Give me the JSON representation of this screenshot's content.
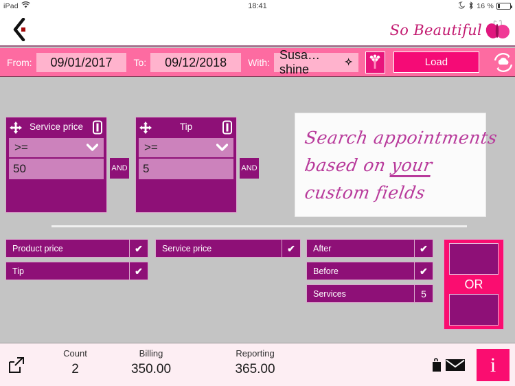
{
  "status_bar": {
    "device": "iPad",
    "wifi_icon": "wifi-icon",
    "time": "18:41",
    "moon_icon": "do-not-disturb-icon",
    "bluetooth_icon": "bluetooth-icon",
    "battery_percent": "16 %"
  },
  "header": {
    "back_icon": "back-chevron-icon",
    "logo_text": "So Beautiful",
    "butterfly_icon": "butterfly-icon"
  },
  "toolbar": {
    "from_label": "From:",
    "from_value": "09/01/2017",
    "to_label": "To:",
    "to_value": "09/12/2018",
    "with_label": "With:",
    "with_value": "Susa…shine",
    "chevron_icon": "chevron-down-icon",
    "filter_icon": "filter-funnel-icon",
    "load_label": "Load",
    "sync_icon": "cloud-sync-icon"
  },
  "filter_cards": [
    {
      "title": "Service price",
      "move_icon": "move-arrows-icon",
      "delete_icon": "trash-icon",
      "operator": ">=",
      "operator_chevron": "chevron-down-icon",
      "value": "50",
      "connector": "AND"
    },
    {
      "title": "Tip",
      "move_icon": "move-arrows-icon",
      "delete_icon": "trash-icon",
      "operator": ">=",
      "operator_chevron": "chevron-down-icon",
      "value": "5",
      "connector": "AND"
    }
  ],
  "note": {
    "line1": "Search appointments",
    "line2a": "based on ",
    "line2b": "your",
    "line3": "custom fields"
  },
  "field_columns": {
    "column1": [
      {
        "label": "Product price",
        "value": "✔"
      },
      {
        "label": "Tip",
        "value": "✔"
      }
    ],
    "column2": [
      {
        "label": "Service price",
        "value": "✔"
      }
    ],
    "column3": [
      {
        "label": "After",
        "value": "✔"
      },
      {
        "label": "Before",
        "value": "✔"
      },
      {
        "label": "Services",
        "value": "5"
      }
    ]
  },
  "or_panel": {
    "label": "OR",
    "slot_top": "drop-slot-top",
    "slot_bottom": "drop-slot-bottom"
  },
  "footer": {
    "export_icon": "export-icon",
    "stats": [
      {
        "caption": "Count",
        "value": "2"
      },
      {
        "caption": "Billing",
        "value": "350.00"
      },
      {
        "caption": "Reporting",
        "value": "365.00"
      }
    ],
    "print_icon": "print-icon",
    "mail_icon": "mail-envelope-icon",
    "info_label": "i"
  },
  "colors": {
    "accent_pink": "#fa0d70",
    "toolbar_pink": "#fd6ba1",
    "purple": "#8e1077",
    "light_purple": "#cc82bc",
    "body_gray": "#c4c4c4"
  }
}
